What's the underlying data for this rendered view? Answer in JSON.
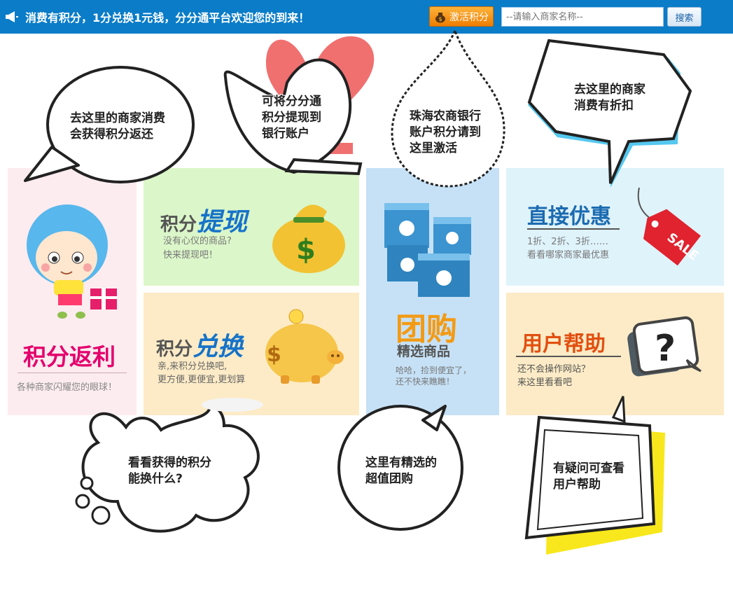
{
  "topbar": {
    "marquee": "消费有积分，1分兑换1元钱，分分通平台欢迎您的到来！",
    "activate_label": "激活积分",
    "search_placeholder": "--请输入商家名称--",
    "search_label": "搜索",
    "icons": {
      "announce": "megaphone-icon",
      "activate": "money-bag-icon"
    }
  },
  "colors": {
    "topbar_bg": "#0a7cc8",
    "fanli_pink": "#e4006d",
    "tixian_blue": "#1673c9",
    "tuangou_orange": "#f39a13",
    "youhui_blue": "#1b6bb0",
    "help_red": "#e24f10"
  },
  "tiles": {
    "fanli": {
      "title": "积分返利",
      "subtitle": "各种商家闪耀您的眼球！"
    },
    "tixian": {
      "title_a": "积分",
      "title_b": "提现",
      "line1": "没有心仪的商品?",
      "line2": "快来提现吧！"
    },
    "duihuan": {
      "title_a": "积分",
      "title_b": "兑换",
      "line1": "亲,来积分兑换吧,",
      "line2": "更方便,更便宜,更划算"
    },
    "tuangou": {
      "title": "团购",
      "subtitle": "精选商品",
      "line1": "哈哈，捡到便宜了，",
      "line2": "还不快来瞧瞧！"
    },
    "youhui": {
      "title": "直接优惠",
      "line1": "1折、2折、3折……",
      "line2": "看看哪家商家最优惠",
      "tag": "SALE"
    },
    "help": {
      "title": "用户帮助",
      "line1": "还不会操作网站？",
      "line2": "来这里看看吧"
    }
  },
  "bubbles": {
    "fanli": {
      "line1": "去这里的商家消费",
      "line2": "会获得积分返还"
    },
    "tixian": {
      "line1": "可将分分通",
      "line2": "积分提现到",
      "line3": "银行账户"
    },
    "activate": {
      "line1": "珠海农商银行",
      "line2": "账户积分请到",
      "line3": "这里激活"
    },
    "youhui": {
      "line1": "去这里的商家",
      "line2": "消费有折扣"
    },
    "duihuan": {
      "line1": "看看获得的积分",
      "line2": "能换什么?"
    },
    "tuangou": {
      "line1": "这里有精选的",
      "line2": "超值团购"
    },
    "help": {
      "line1": "有疑问可查看",
      "line2": "用户帮助"
    }
  }
}
